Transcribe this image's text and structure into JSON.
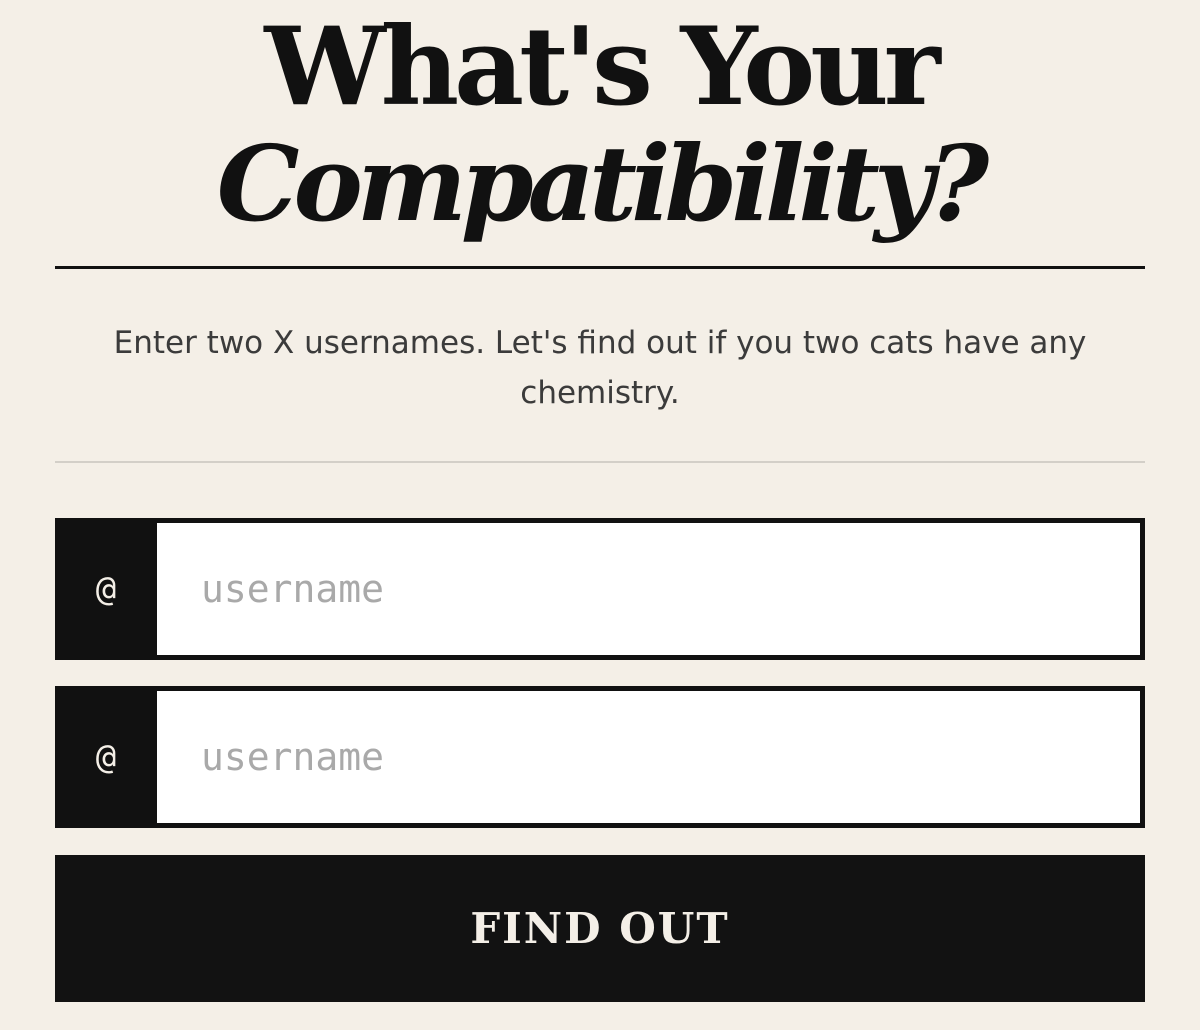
{
  "header": {
    "title_line1": "What's Your",
    "title_line2": "Compatibility?"
  },
  "intro": {
    "text": "Enter two X usernames. Let's find out if you two cats have any chemistry."
  },
  "form": {
    "fields": [
      {
        "prefix": "@",
        "placeholder": "username",
        "value": ""
      },
      {
        "prefix": "@",
        "placeholder": "username",
        "value": ""
      }
    ],
    "submit_label": "FIND OUT"
  },
  "colors": {
    "background": "#f4efe7",
    "ink": "#111111",
    "placeholder": "#a9a9a9",
    "divider": "#d3cfc8"
  }
}
